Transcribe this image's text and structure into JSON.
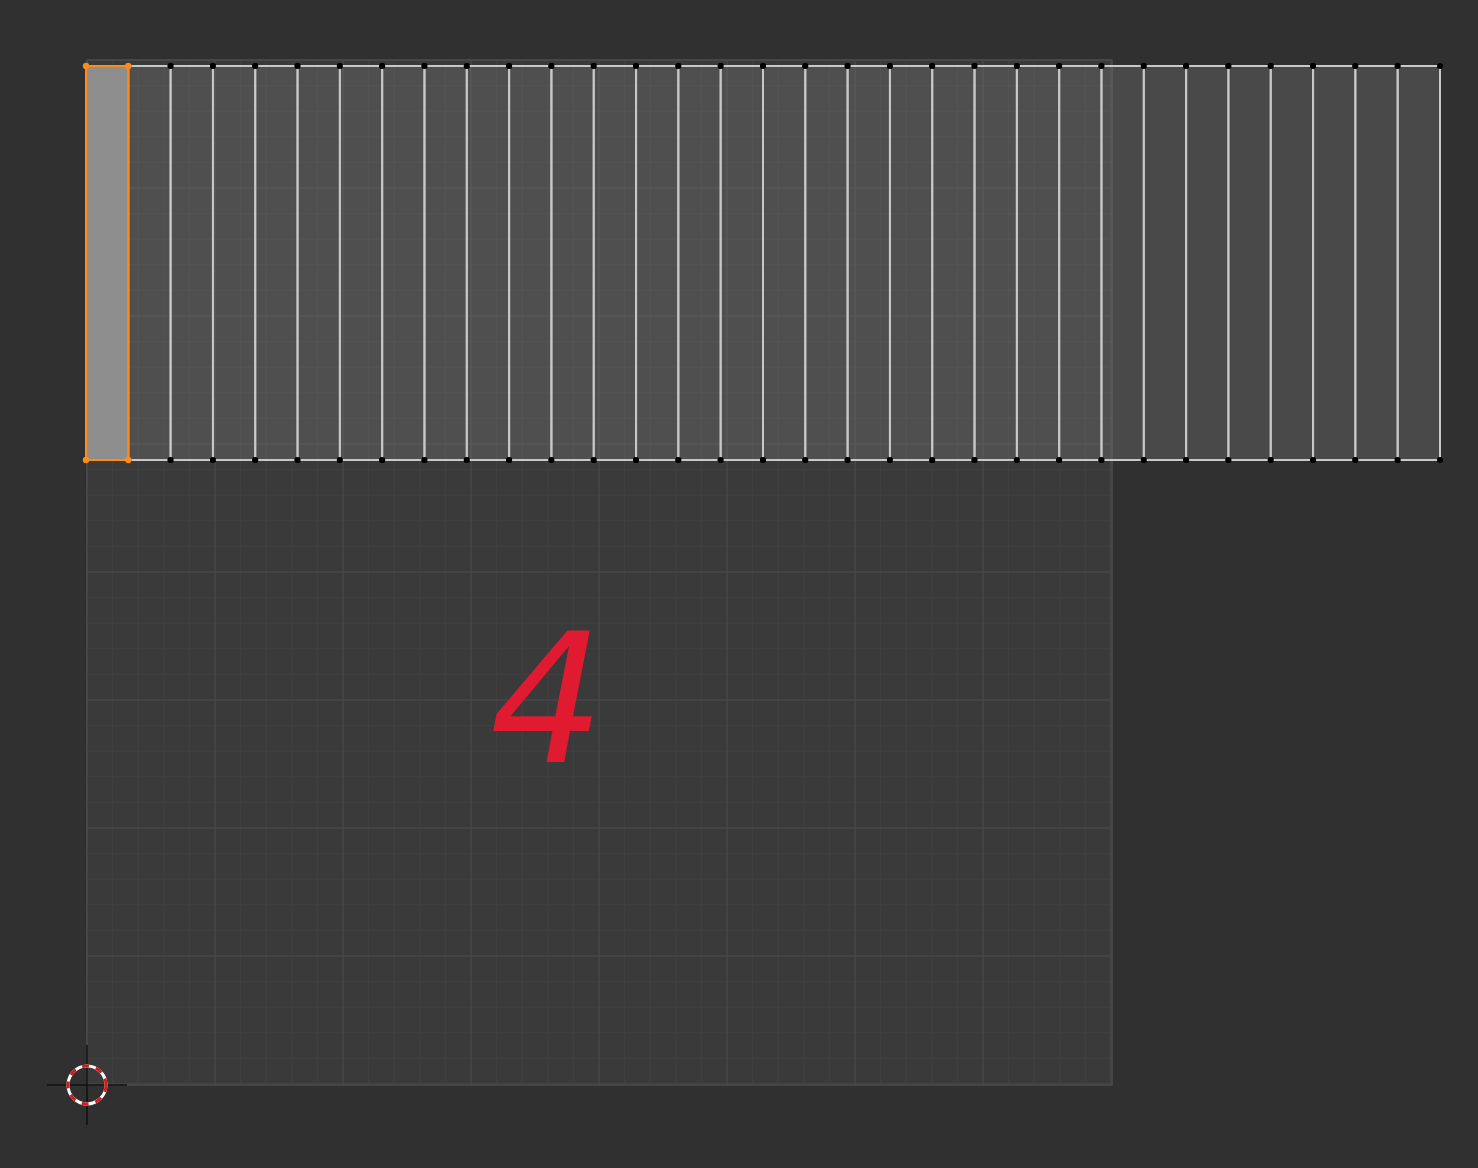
{
  "uv_editor": {
    "annotation": "4",
    "faces": [
      {
        "selected": true
      },
      {
        "selected": false
      },
      {
        "selected": false
      },
      {
        "selected": false
      },
      {
        "selected": false
      },
      {
        "selected": false
      },
      {
        "selected": false
      },
      {
        "selected": false
      },
      {
        "selected": false
      },
      {
        "selected": false
      },
      {
        "selected": false
      },
      {
        "selected": false
      },
      {
        "selected": false
      },
      {
        "selected": false
      },
      {
        "selected": false
      },
      {
        "selected": false
      },
      {
        "selected": false
      },
      {
        "selected": false
      },
      {
        "selected": false
      },
      {
        "selected": false
      },
      {
        "selected": false
      },
      {
        "selected": false
      },
      {
        "selected": false
      },
      {
        "selected": false
      },
      {
        "selected": false
      },
      {
        "selected": false
      },
      {
        "selected": false
      },
      {
        "selected": false
      },
      {
        "selected": false
      },
      {
        "selected": false
      },
      {
        "selected": false
      },
      {
        "selected": false
      }
    ]
  }
}
